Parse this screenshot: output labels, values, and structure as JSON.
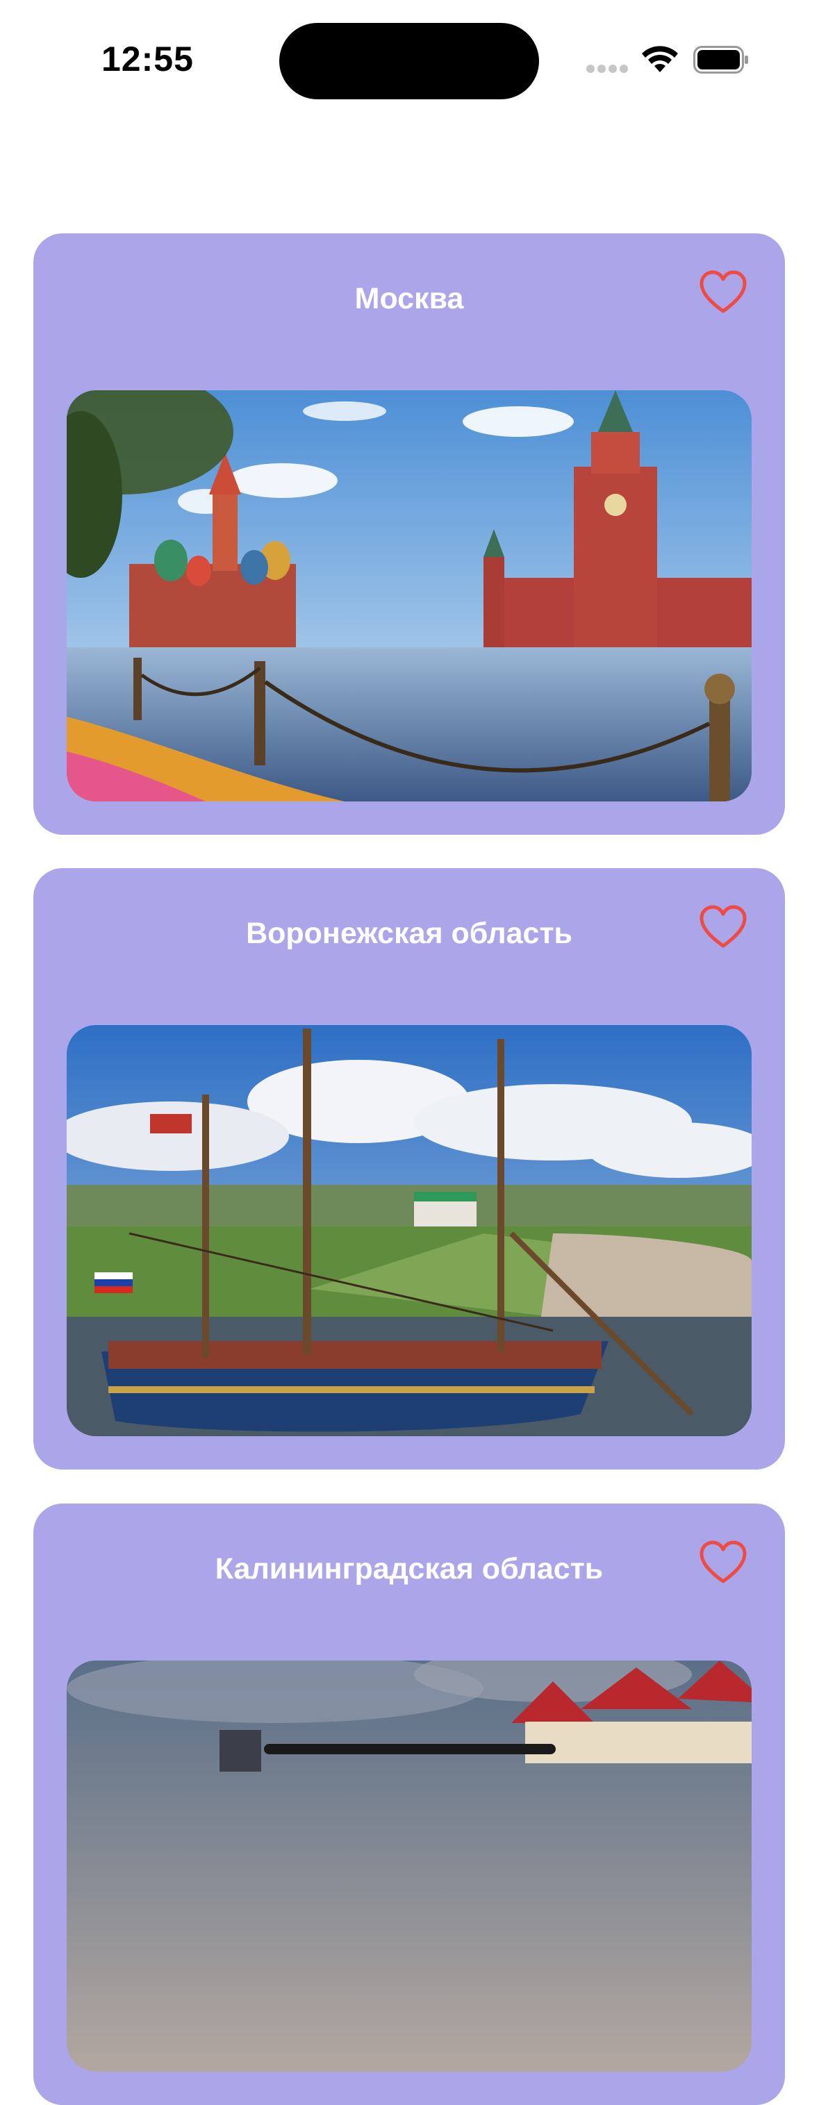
{
  "status_bar": {
    "time": "12:55"
  },
  "regions": [
    {
      "title": "Москва",
      "favorite": false
    },
    {
      "title": "Воронежская область",
      "favorite": false
    },
    {
      "title": "Калининградская область",
      "favorite": false
    }
  ],
  "colors": {
    "card_background": "#aba6ea",
    "heart": "#ef4b43",
    "title_text": "#ffffff"
  },
  "icons": {
    "favorite": "heart-outline-icon",
    "wifi": "wifi-icon",
    "battery": "battery-icon"
  }
}
